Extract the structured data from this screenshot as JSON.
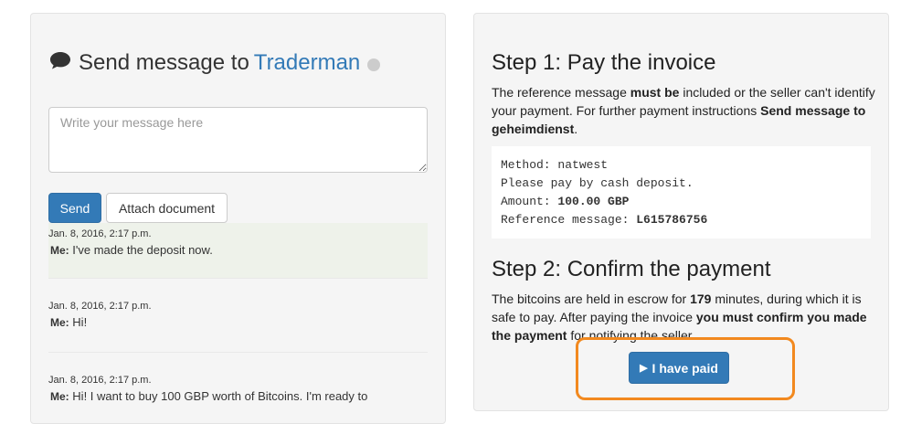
{
  "left_panel": {
    "title_prefix": "Send message to",
    "recipient": "Traderman",
    "icons": {
      "chat": "comment-icon",
      "status": "status-dot-icon"
    },
    "input_placeholder": "Write your message here",
    "send_label": "Send",
    "attach_label": "Attach document",
    "messages": [
      {
        "timestamp": "Jan. 8, 2016, 2:17 p.m.",
        "sender": "Me:",
        "text": "I've made the deposit now."
      },
      {
        "timestamp": "Jan. 8, 2016, 2:17 p.m.",
        "sender": "Me:",
        "text": "Hi!"
      },
      {
        "timestamp": "Jan. 8, 2016, 2:17 p.m.",
        "sender": "Me:",
        "text": "Hi! I want to buy 100 GBP worth of Bitcoins. I'm ready to"
      }
    ]
  },
  "right_panel": {
    "step1_title": "Step 1: Pay the invoice",
    "step1_p1": "The reference message ",
    "step1_b1": "must be",
    "step1_p2": " included or the seller can't identify your payment. For further payment instructions ",
    "step1_b2": "Send message to geheimdienst",
    "step1_p3": ".",
    "payment": {
      "method_label": "Method: ",
      "method": "natwest",
      "instruction": "Please pay by cash deposit.",
      "amount_label": "Amount: ",
      "amount": "100.00 GBP",
      "reference_label": "Reference message: ",
      "reference": "L615786756"
    },
    "step2_title": "Step 2: Confirm the payment",
    "step2_p1": "The bitcoins are held in escrow for ",
    "step2_b1": "179",
    "step2_p2": " minutes, during which it is safe to pay. After paying the invoice ",
    "step2_b2": "you must confirm you made the payment",
    "step2_p3": " for notifying the seller.",
    "paid_label": "I have paid",
    "paid_icon": "play-icon"
  },
  "colors": {
    "primary": "#337ab7",
    "highlight": "#f2891f",
    "panel_bg": "#f5f5f5"
  }
}
